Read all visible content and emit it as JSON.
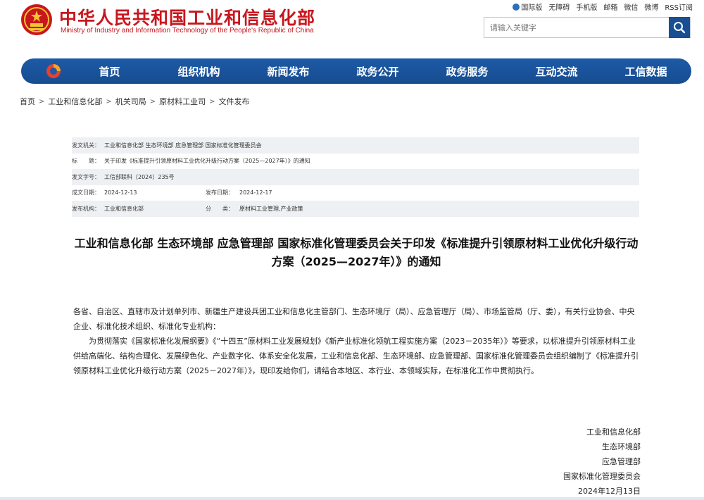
{
  "header": {
    "title_cn": "中华人民共和国工业和信息化部",
    "title_en": "Ministry of Industry and Information Technology of the People's Republic of China",
    "toplinks": [
      "国际版",
      "无障碍",
      "手机版",
      "邮箱",
      "微信",
      "微博",
      "RSS订阅"
    ]
  },
  "search": {
    "placeholder": "请输入关键字"
  },
  "nav": {
    "items": [
      "首页",
      "组织机构",
      "新闻发布",
      "政务公开",
      "政务服务",
      "互动交流",
      "工信数据"
    ]
  },
  "breadcrumb": [
    "首页",
    "工业和信息化部",
    "机关司局",
    "原材料工业司",
    "文件发布"
  ],
  "info": {
    "issuer_label": "发文机关：",
    "issuer": "工业和信息化部 生态环境部 应急管理部 国家标准化管理委员会",
    "title_label": "标　　题：",
    "title": "关于印发《标准提升引领原材料工业优化升级行动方案（2025—2027年）》的通知",
    "doc_no_label": "发文字号：",
    "doc_no": "工信部联科〔2024〕235号",
    "written_label": "成文日期：",
    "written": "2024-12-13",
    "published_label": "发布日期：",
    "published": "2024-12-17",
    "agency_label": "发布机构：",
    "agency": "工业和信息化部",
    "category_label": "分　　类：",
    "category": "原材料工业管理,产业政策"
  },
  "doc": {
    "title": "工业和信息化部 生态环境部 应急管理部 国家标准化管理委员会关于印发《标准提升引领原材料工业优化升级行动方案（2025—2027年）》的通知",
    "para1": "各省、自治区、直辖市及计划单列市、新疆生产建设兵团工业和信息化主管部门、生态环境厅（局）、应急管理厅（局）、市场监管局（厅、委），有关行业协会、中央企业、标准化技术组织、标准化专业机构：",
    "para2": "为贯彻落实《国家标准化发展纲要》《“十四五”原材料工业发展规划》《新产业标准化领航工程实施方案（2023－2035年）》等要求，以标准提升引领原材料工业供给高端化、结构合理化、发展绿色化、产业数字化、体系安全化发展，工业和信息化部、生态环境部、应急管理部、国家标准化管理委员会组织编制了《标准提升引领原材料工业优化升级行动方案（2025－2027年）》，现印发给你们，请结合本地区、本行业、本领域实际，在标准化工作中贯彻执行。",
    "signers": [
      "工业和信息化部",
      "生态环境部",
      "应急管理部",
      "国家标准化管理委员会",
      "2024年12月13日"
    ]
  },
  "colors": {
    "brand_red": "#c8161d",
    "nav_blue": "#1d5aa6"
  }
}
